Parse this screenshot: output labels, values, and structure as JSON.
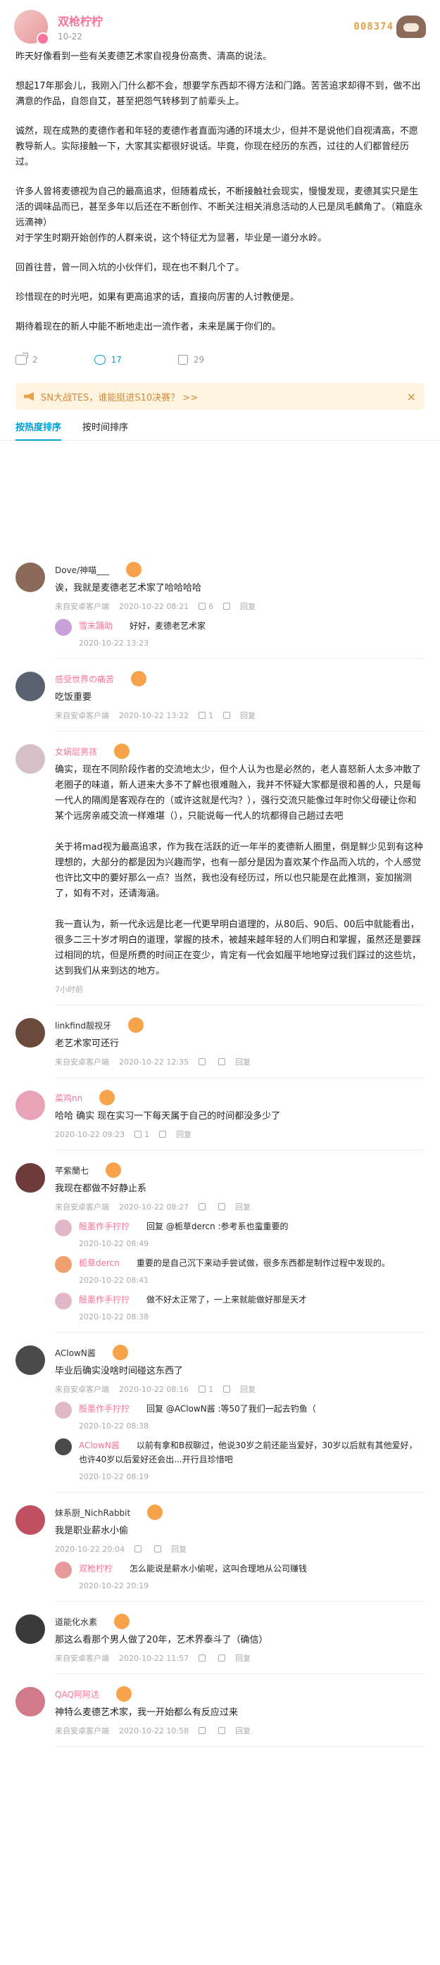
{
  "header": {
    "username": "双枪柠柠",
    "date": "10-22",
    "fan_number": "008374"
  },
  "post": {
    "paragraphs": [
      "昨天好像看到一些有关麦德艺术家自视身份高贵、清高的说法。",
      "想起17年那会儿，我刚入门什么都不会，想要学东西却不得方法和门路。苦苦追求却得不到，做不出满意的作品，自怨自艾，甚至把怨气转移到了前辈头上。",
      "诚然，现在成熟的麦德作者和年轻的麦德作者直面沟通的环境太少，但并不是说他们自视清高，不愿教导新人。实际接触一下，大家其实都很好说话。毕竟，你现在经历的东西，过往的人们都曾经历过。",
      "许多人曾将麦德视为自己的最高追求，但随着成长，不断接触社会现实，慢慢发现，麦德其实只是生活的调味品而已，甚至多年以后还在不断创作、不断关注相关消息活动的人已是凤毛麟角了。（箱庭永远滴神）\n对于学生时期开始创作的人群来说，这个特征尤为显著，毕业是一道分水岭。",
      "回首往昔，曾一同入坑的小伙伴们，现在也不剩几个了。",
      "珍惜现在的时光吧，如果有更高追求的话，直接向厉害的人讨教便是。",
      "期待着现在的新人中能不断地走出一流作者，未来是属于你们的。"
    ]
  },
  "actions": {
    "share_count": "2",
    "comment_count": "17",
    "like_count": "29"
  },
  "notice": {
    "text": "SN大战TES，谁能挺进S10决赛？ >>",
    "close": "×"
  },
  "tabs": [
    {
      "label": "按热度排序"
    },
    {
      "label": "按时间排序"
    }
  ],
  "comments": [
    {
      "name": "Dove/神喵___",
      "text": "诶，我就是麦德老艺术家了哈哈哈哈",
      "source": "来自安卓客户端",
      "time": "2020-10-22 08:21",
      "likes": "6",
      "reply_label": "回复",
      "avatar_color": "#8b6a5a",
      "vip": false,
      "replies": [
        {
          "name": "雪末踊助",
          "text": "好好，麦德老艺术家",
          "time": "2020-10-22 13:23",
          "avatar_color": "#c9a0d8"
        }
      ]
    },
    {
      "name": "感受世界の痛苦",
      "text": "吃饭重要",
      "source": "来自安卓客户端",
      "time": "2020-10-22 13:22",
      "likes": "1",
      "reply_label": "回复",
      "avatar_color": "#5a6270",
      "vip": true,
      "replies": []
    },
    {
      "name": "女娲层男孩",
      "text": "确实，现在不同阶段作者的交流地太少，但个人认为也是必然的，老人喜怒新人太多冲散了老圈子的味道，新人进来大多不了解也很难融入，我并不怀疑大家都是很和善的人，只是每一代人的隔阂是客观存在的（或许这就是代沟？），强行交流只能像过年时你父母硬让你和某个远房亲戚交流一样难堪（），只能说每一代人的坑都得自己趟过去吧\n\n关于将mad视为最高追求，作为我在活跃的近一年半的麦德新人圈里，倒是鲜少见到有这种理想的，大部分的都是因为兴趣而学，也有一部分是因为喜欢某个作品而入坑的，个人感觉也许比文中的要好那么一点？当然，我也没有经历过，所以也只能是在此推测，妄加揣测了，如有不对，还请海涵。\n\n我一直认为，新一代永远是比老一代更早明白道理的，从80后、90后、00后中就能看出，很多二三十岁才明白的道理，掌握的技术，被越来越年轻的人们明白和掌握，虽然还是要踩过相同的坑，但是所费的时间正在变少，肯定有一代会如履平地地穿过我们踩过的这些坑，达到我们从来到达的地方。",
      "source": "7小时前",
      "time": "",
      "likes": "",
      "reply_label": "",
      "avatar_color": "#d6c0c8",
      "vip": true,
      "replies": []
    },
    {
      "name": "linkfind靓视牙",
      "text": "老艺术家可还行",
      "source": "来自安卓客户端",
      "time": "2020-10-22 12:35",
      "likes": "",
      "reply_label": "回复",
      "avatar_color": "#6a4a3a",
      "vip": false,
      "replies": []
    },
    {
      "name": "菜鸡nn",
      "text": "哈哈 确实 现在实习一下每天属于自己的时间都没多少了",
      "source": "2020-10-22 09:23",
      "time": "",
      "likes": "1",
      "reply_label": "回复",
      "avatar_color": "#e9a3b9",
      "vip": true,
      "replies": []
    },
    {
      "name": "芊紫蘭七",
      "text": "我现在都做不好静止系",
      "source": "来自安卓客户端",
      "time": "2020-10-22 08:27",
      "likes": "",
      "reply_label": "回复",
      "avatar_color": "#6e3a3a",
      "vip": false,
      "replies": [
        {
          "name": "殷墨作手拧拧",
          "at": "@栀草dercn",
          "text": "回复 @栀草dercn :参考系也蛮重要的",
          "time": "2020-10-22 08:49",
          "avatar_color": "#e0b8c8"
        },
        {
          "name": "栀草dercn",
          "text": "重要的是自己沉下来动手尝试做，很多东西都是制作过程中发现的。",
          "time": "2020-10-22 08:41",
          "avatar_color": "#f0a070"
        },
        {
          "name": "殷墨作手拧拧",
          "text": "做不好太正常了，一上来就能做好那是天才",
          "time": "2020-10-22 08:38",
          "avatar_color": "#e0b8c8"
        }
      ]
    },
    {
      "name": "AClowN酱",
      "text": "毕业后确实没啥时间碰这东西了",
      "source": "来自安卓客户端",
      "time": "2020-10-22 08:16",
      "likes": "1",
      "reply_label": "回复",
      "avatar_color": "#4a4a4a",
      "vip": false,
      "replies": [
        {
          "name": "殷墨作手拧拧",
          "at": "@AClowN酱",
          "text": "回复 @AClowN酱 :等50了我们一起去钓鱼（",
          "time": "2020-10-22 08:38",
          "avatar_color": "#e0b8c8"
        },
        {
          "name": "AClowN酱",
          "text": "以前有拿和B叔聊过，他说30岁之前还能当爱好，30岁以后就有其他爱好，也许40岁以后爱好还会出...开行且珍惜吧",
          "time": "2020-10-22 08:19",
          "avatar_color": "#4a4a4a"
        }
      ]
    },
    {
      "name": "妹系厨_NichRabbit",
      "text": "我是职业薪水小偷",
      "source": "2020-10-22 20:04",
      "time": "",
      "likes": "",
      "reply_label": "回复",
      "avatar_color": "#c05060",
      "vip": false,
      "replies": [
        {
          "name": "双枪柠柠",
          "text": "怎么能说是薪水小偷呢，这叫合理地从公司赚钱",
          "time": "2020-10-22 20:19",
          "avatar_color": "#e79a9a"
        }
      ]
    },
    {
      "name": "道能化水素",
      "text": "那这么看那个男人做了20年，艺术界泰斗了（确信）",
      "source": "来自安卓客户端",
      "time": "2020-10-22 11:57",
      "likes": "",
      "reply_label": "回复",
      "avatar_color": "#3a3a3a",
      "vip": false,
      "replies": []
    },
    {
      "name": "QAQ阿阿达",
      "text": "神特么麦德艺术家，我一开始都么有反应过来",
      "source": "来自安卓客户端",
      "time": "2020-10-22 10:58",
      "likes": "",
      "reply_label": "回复",
      "avatar_color": "#d07a8a",
      "vip": true,
      "replies": []
    }
  ]
}
